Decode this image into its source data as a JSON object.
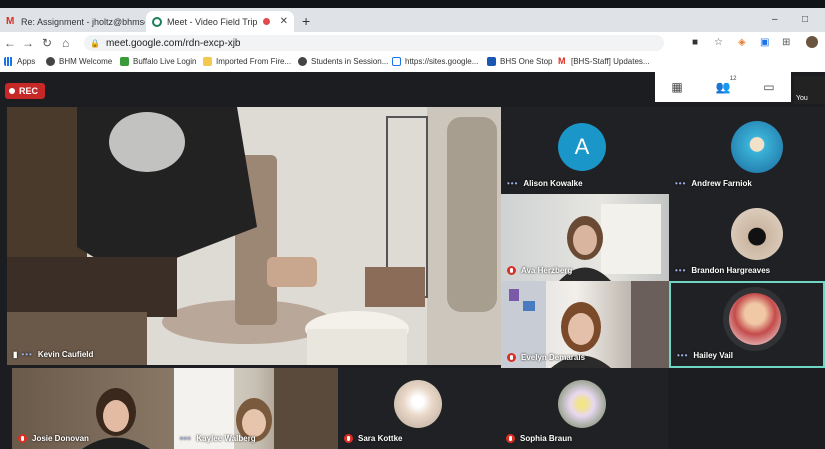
{
  "browser": {
    "tabs": [
      {
        "label": "Re: Assignment - jholtz@bhmscl",
        "active": false
      },
      {
        "label": "Meet - Video Field Trip",
        "active": true
      }
    ],
    "new_tab": "+",
    "window_controls": [
      "–",
      "□"
    ],
    "url": "meet.google.com/rdn-excp-xjb",
    "bookmarks": [
      {
        "label": "Apps",
        "icon": "apps-grid-icon"
      },
      {
        "label": "BHM Welcome",
        "icon": "globe-icon"
      },
      {
        "label": "Buffalo Live Login",
        "icon": "green-square-icon"
      },
      {
        "label": "Imported From Fire...",
        "icon": "folder-icon"
      },
      {
        "label": "Students in Session...",
        "icon": "globe-icon"
      },
      {
        "label": "https://sites.google...",
        "icon": "page-icon"
      },
      {
        "label": "BHS One Stop",
        "icon": "blue-grid-icon"
      },
      {
        "label": "[BHS-Staff] Updates...",
        "icon": "gmail-icon"
      }
    ]
  },
  "meet": {
    "rec_label": "REC",
    "participant_count": "12",
    "you_label": "You",
    "main_speaker": "Kevin Caufield",
    "participants": [
      {
        "name": "Alison Kowalke",
        "muted": false,
        "avatar": "A"
      },
      {
        "name": "Andrew Farniok",
        "muted": false
      },
      {
        "name": "Ava Herzberg",
        "muted": true
      },
      {
        "name": "Brandon Hargreaves",
        "muted": false
      },
      {
        "name": "Evelyn Demarais",
        "muted": true
      },
      {
        "name": "Hailey Vail",
        "muted": false
      },
      {
        "name": "Josie Donovan",
        "muted": true
      },
      {
        "name": "Kaylee Walberg",
        "muted": false
      },
      {
        "name": "Sara Kottke",
        "muted": true
      },
      {
        "name": "Sophia Braun",
        "muted": true
      }
    ],
    "colors": {
      "accent_border": "#6fd6c3",
      "muted_red": "#d93025",
      "avatar_blue": "#1a97c8",
      "rec_red": "#c62828"
    }
  }
}
